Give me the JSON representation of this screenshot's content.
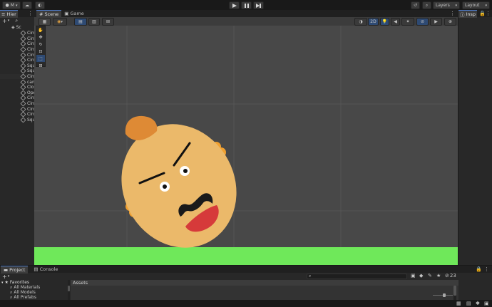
{
  "topbar": {
    "account_label": "M",
    "play_icon": "play-icon",
    "pause_icon": "pause-icon",
    "step_icon": "step-icon",
    "layers_label": "Layers",
    "layout_label": "Layout"
  },
  "hierarchy": {
    "tab_label": "Hier",
    "scene_label": "Sc",
    "items": [
      "Circ",
      "Circ",
      "Circ",
      "Circ",
      "Circ",
      "Circ",
      "Squ",
      "Squ",
      "Circ",
      "can",
      "Clo",
      "Ope",
      "Circ",
      "Circ",
      "Circ",
      "Circ",
      "Squ"
    ]
  },
  "scene_tabs": {
    "scene": "Scene",
    "game": "Game"
  },
  "scene_toolbar": {
    "mode_2d": "2D"
  },
  "inspector": {
    "tab_label": "Insp"
  },
  "bottom": {
    "tabs": {
      "project": "Project",
      "console": "Console"
    },
    "favorites_label": "Favorites",
    "favorites": [
      "All Materials",
      "All Models",
      "All Prefabs"
    ],
    "assets_label": "Assets",
    "hidden_count": "23"
  },
  "colors": {
    "accent": "#4d79c6",
    "ground": "#6fe85a",
    "face": "#ebb96a",
    "hair": "#de8a35",
    "mouth": "#d63a3a",
    "scene_bg": "#484848"
  }
}
